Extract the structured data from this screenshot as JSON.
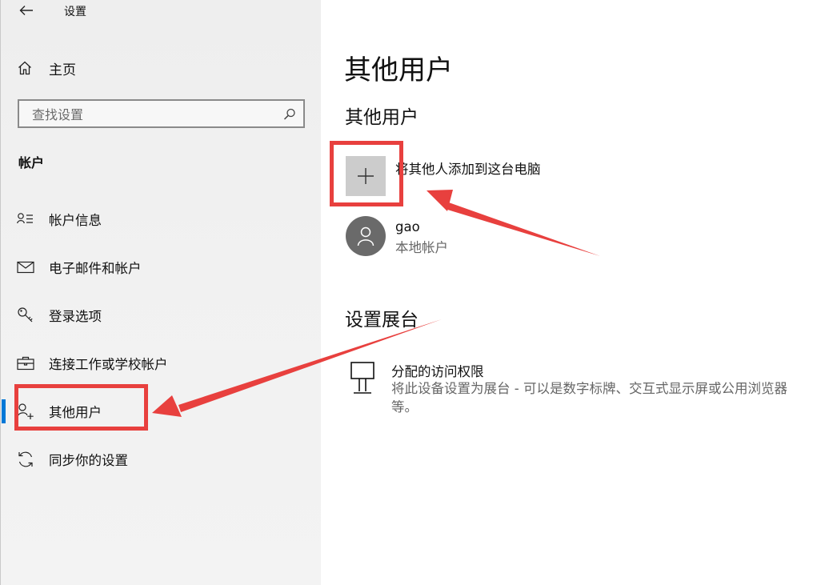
{
  "window": {
    "title": "设置"
  },
  "sidebar": {
    "home_label": "主页",
    "search_placeholder": "查找设置",
    "section_label": "帐户",
    "items": [
      {
        "label": "帐户信息",
        "icon": "account-info-icon"
      },
      {
        "label": "电子邮件和帐户",
        "icon": "mail-icon"
      },
      {
        "label": "登录选项",
        "icon": "key-icon"
      },
      {
        "label": "连接工作或学校帐户",
        "icon": "briefcase-icon"
      },
      {
        "label": "其他用户",
        "icon": "add-person-icon",
        "selected": true
      },
      {
        "label": "同步你的设置",
        "icon": "sync-icon"
      }
    ]
  },
  "main": {
    "title": "其他用户",
    "other_users": {
      "heading": "其他用户",
      "add_label": "将其他人添加到这台电脑",
      "users": [
        {
          "name": "gao",
          "type": "本地帐户"
        }
      ]
    },
    "kiosk": {
      "heading": "设置展台",
      "title": "分配的访问权限",
      "description": "将此设备设置为展台 - 可以是数字标牌、交互式显示屏或公用浏览器等。"
    }
  },
  "colors": {
    "accent": "#0078d7",
    "annotation_red": "#e8403e",
    "sidebar_bg": "#f0f0f0",
    "tile_gray": "#cccccc",
    "avatar_gray": "#6a6a6a"
  }
}
